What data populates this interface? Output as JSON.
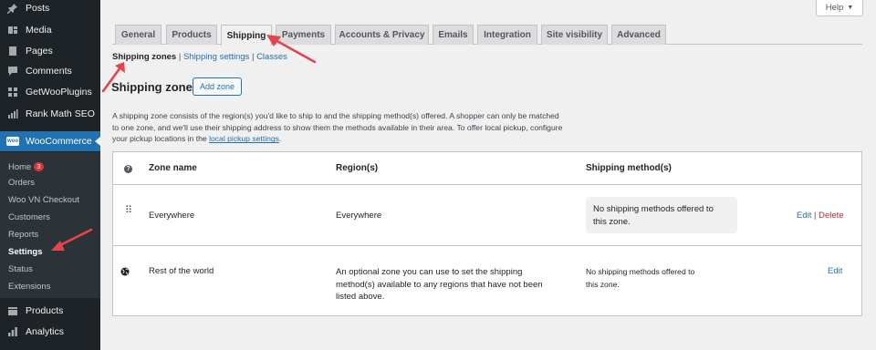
{
  "sidebar": {
    "top_items": [
      {
        "label": "Posts",
        "icon": "pin-icon"
      },
      {
        "label": "Media",
        "icon": "media-icon"
      },
      {
        "label": "Pages",
        "icon": "pages-icon"
      },
      {
        "label": "Comments",
        "icon": "comments-icon"
      },
      {
        "label": "GetWooPlugins",
        "icon": "plugin-grid-icon"
      },
      {
        "label": "Rank Math SEO",
        "icon": "chart-icon"
      }
    ],
    "woocommerce_label": "WooCommerce",
    "woo_logo_text": "woo",
    "submenu": {
      "home": "Home",
      "home_badge": "3",
      "orders": "Orders",
      "woo_vn_checkout": "Woo VN Checkout",
      "customers": "Customers",
      "reports": "Reports",
      "settings": "Settings",
      "status": "Status",
      "extensions": "Extensions"
    },
    "bottom_items": [
      {
        "label": "Products",
        "icon": "products-icon"
      },
      {
        "label": "Analytics",
        "icon": "analytics-icon"
      }
    ]
  },
  "help": {
    "label": "Help",
    "arrow": "▼"
  },
  "tabs": [
    "General",
    "Products",
    "Shipping",
    "Payments",
    "Accounts & Privacy",
    "Emails",
    "Integration",
    "Site visibility",
    "Advanced"
  ],
  "active_tab": "Shipping",
  "subnav": {
    "current": "Shipping zones",
    "sep1": " | ",
    "settings": "Shipping settings",
    "sep2": " | ",
    "classes": "Classes"
  },
  "page": {
    "title": "Shipping zones",
    "add_zone": "Add zone",
    "desc_1": "A shipping zone consists of the region(s) you'd like to ship to and the shipping method(s) offered. A shopper can only be matched",
    "desc_2": "to one zone, and we'll use their shipping address to show them the methods available in their area. To offer local pickup, configure",
    "desc_3_pre": "your pickup locations in the ",
    "desc_3_link": "local pickup settings",
    "desc_3_post": "."
  },
  "table": {
    "help_icon": "?",
    "headers": {
      "zone": "Zone name",
      "region": "Region(s)",
      "method": "Shipping method(s)"
    },
    "rows": [
      {
        "zone": "Everywhere",
        "region": "Everywhere",
        "method_1": "No shipping methods offered to",
        "method_2": "this zone.",
        "edit": "Edit",
        "sep": "|",
        "delete": "Delete"
      },
      {
        "zone": "Rest of the world",
        "region_1": "An optional zone you can use to set the shipping",
        "region_2": "method(s) available to any regions that have not been",
        "region_3": "listed above.",
        "method_1": "No shipping methods offered to",
        "method_2": "this zone.",
        "edit": "Edit"
      }
    ]
  },
  "colors": {
    "accent": "#2271b1",
    "sidebar": "#1d2327",
    "submenu": "#2c3338",
    "delete": "#b32d2e",
    "arrow": "#e4444a"
  }
}
